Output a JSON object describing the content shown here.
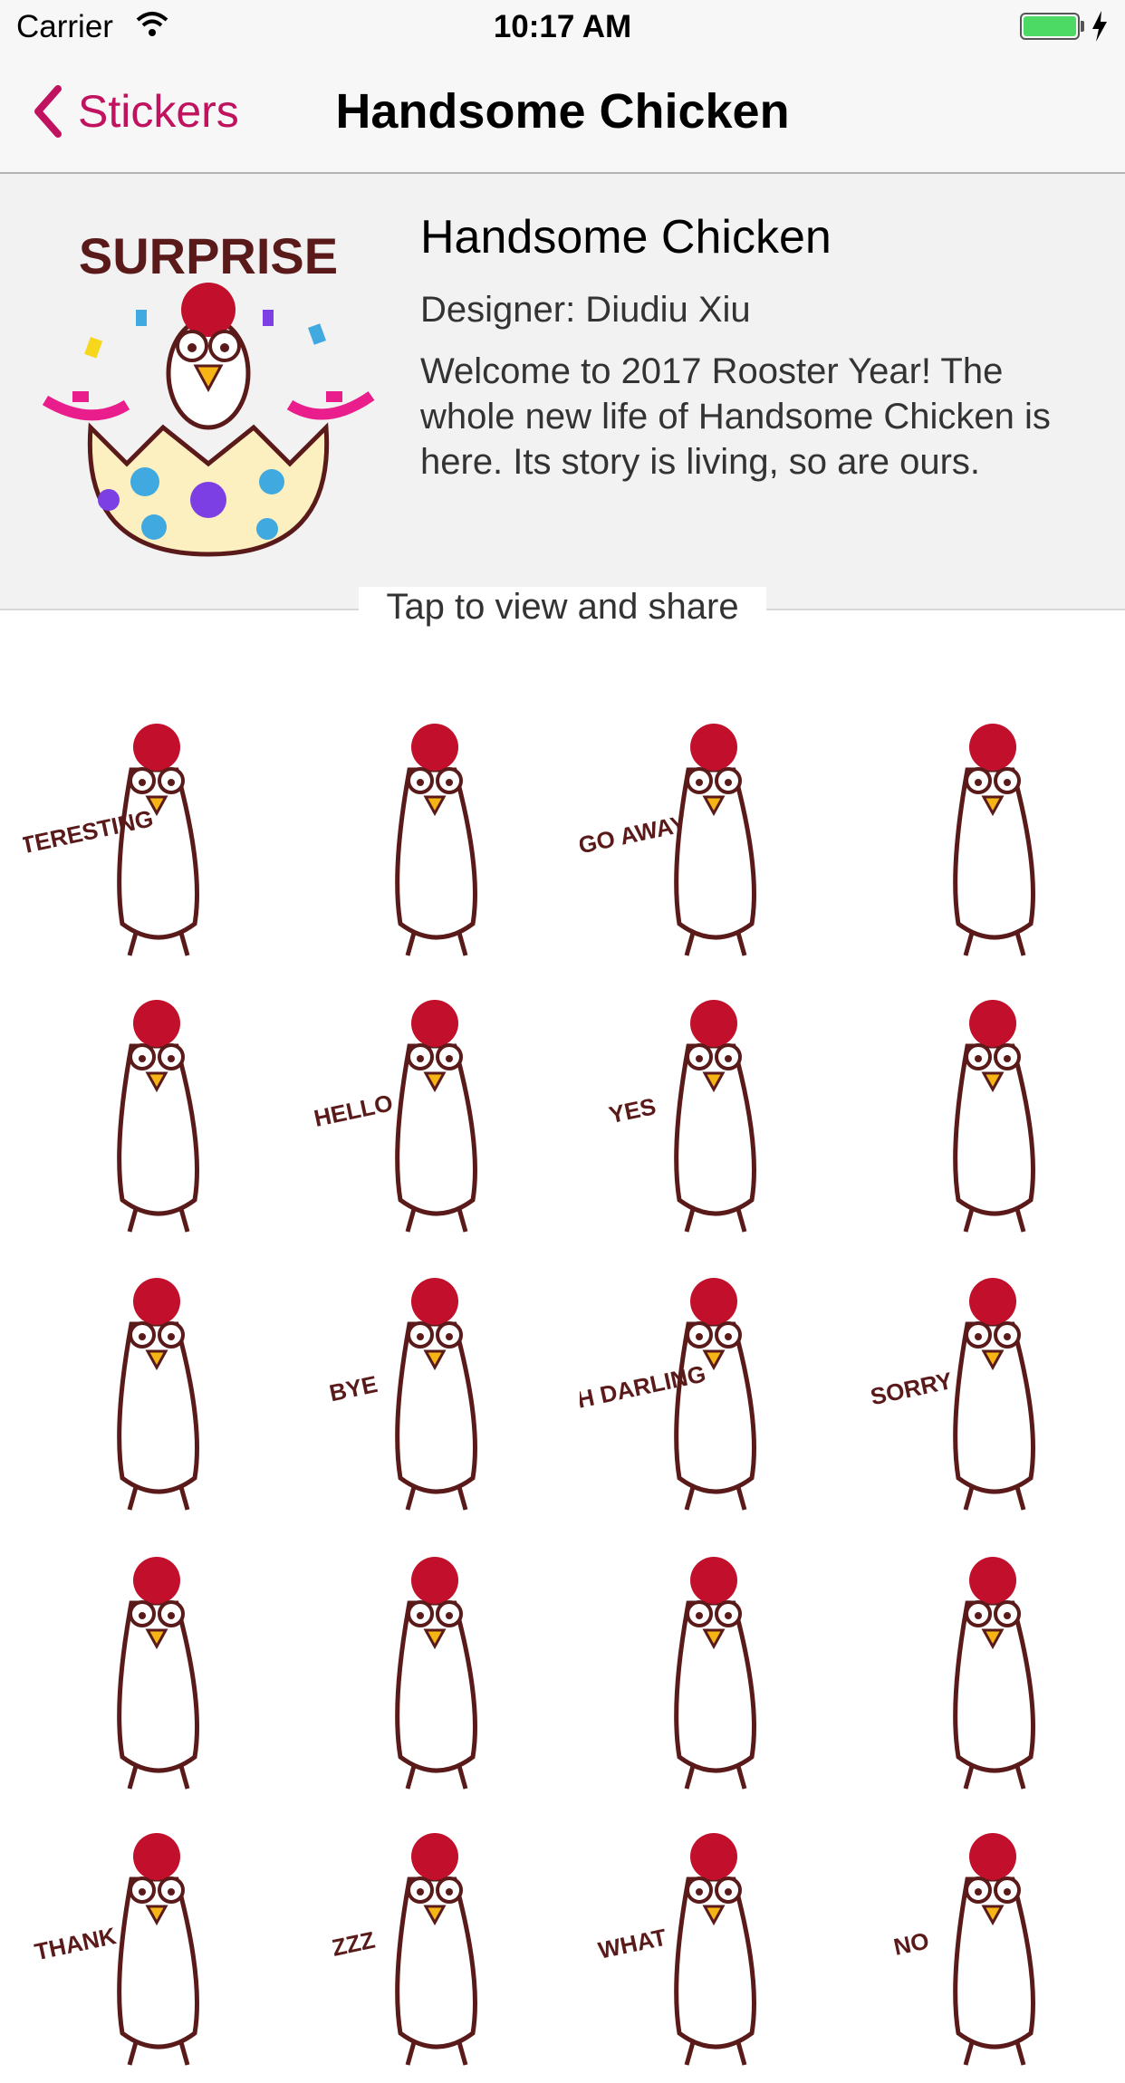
{
  "status_bar": {
    "carrier": "Carrier",
    "time": "10:17 AM"
  },
  "nav": {
    "back_label": "Stickers",
    "title": "Handsome Chicken"
  },
  "pack": {
    "name": "Handsome Chicken",
    "designer": "Designer: Diudiu Xiu",
    "description": "Welcome to 2017 Rooster Year! The whole new life of Handsome Chicken is here. Its story is living, so are ours.",
    "hero_text": "SURPRISE"
  },
  "tap_label": "Tap to view and share",
  "colors": {
    "accent": "#c0125e",
    "comb": "#c2102c",
    "outline": "#5a1a1a"
  },
  "stickers": [
    {
      "icon": "chicken-interesting-sticker",
      "text": "INTERESTING"
    },
    {
      "icon": "chicken-heart-sticker",
      "text": ""
    },
    {
      "icon": "chicken-go-away-sticker",
      "text": "GO AWAY"
    },
    {
      "icon": "chicken-shadow-sticker",
      "text": ""
    },
    {
      "icon": "chicken-clapping-sticker",
      "text": ""
    },
    {
      "icon": "chicken-hello-sticker",
      "text": "HELLO"
    },
    {
      "icon": "chicken-yes-sign-sticker",
      "text": "YES"
    },
    {
      "icon": "chicken-dots-sticker",
      "text": ""
    },
    {
      "icon": "chicken-love-sticker",
      "text": ""
    },
    {
      "icon": "chicken-bye-sticker",
      "text": "BYE"
    },
    {
      "icon": "chicken-oh-darling-sticker",
      "text": "OH DARLING"
    },
    {
      "icon": "chicken-sorry-sticker",
      "text": "SORRY"
    },
    {
      "icon": "chicken-angry-fire-sticker",
      "text": ""
    },
    {
      "icon": "chicken-shocked-sticker",
      "text": ""
    },
    {
      "icon": "chicken-tongue-sticker",
      "text": ""
    },
    {
      "icon": "chicken-crying-sticker",
      "text": ""
    },
    {
      "icon": "chicken-thanks-sticker",
      "text": "THANK"
    },
    {
      "icon": "chicken-sleeping-sticker",
      "text": "ZZZ"
    },
    {
      "icon": "chicken-what-sticker",
      "text": "WHAT"
    },
    {
      "icon": "chicken-no-sign-sticker",
      "text": "NO"
    }
  ]
}
